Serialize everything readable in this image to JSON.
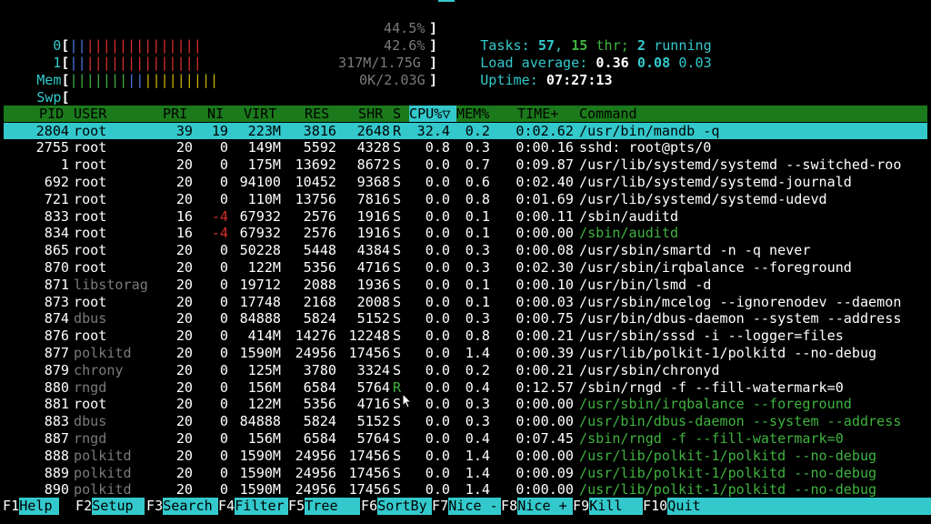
{
  "meters": {
    "cpu0": {
      "label": "0",
      "percent": "44.5%",
      "bars_blue": "||",
      "bars_red": "||||||||||||||"
    },
    "cpu1": {
      "label": "1",
      "percent": "42.6%",
      "bars_blue": "||",
      "bars_red": "||||||||||||||"
    },
    "mem": {
      "label": "Mem",
      "value": "317M/1.75G",
      "bars_green": "|||||||",
      "bars_blue": "||",
      "bars_yellow": "|||||||||"
    },
    "swp": {
      "label": "Swp",
      "value": "0K/2.03G"
    }
  },
  "summary": {
    "tasks_label": "Tasks:",
    "tasks": "57",
    "thr": "15",
    "thr_label": "thr;",
    "running": "2",
    "running_label": "running",
    "load_label": "Load average:",
    "load1": "0.36",
    "load5": "0.08",
    "load15": "0.03",
    "uptime_label": "Uptime:",
    "uptime": "07:27:13"
  },
  "columns": {
    "pid": "PID",
    "user": "USER",
    "pri": "PRI",
    "ni": "NI",
    "virt": "VIRT",
    "res": "RES",
    "shr": "SHR",
    "s": "S",
    "cpu": "CPU%▽",
    "mem": "MEM%",
    "time": "TIME+",
    "command": "Command"
  },
  "processes": [
    {
      "pid": "2804",
      "user": "root",
      "pri": "39",
      "ni": "19",
      "virt": "223M",
      "res": "3816",
      "shr": "2648",
      "s": "R",
      "cpu": "32.4",
      "mem": "0.2",
      "time": "0:02.62",
      "command": "/usr/bin/mandb -q"
    },
    {
      "pid": "2755",
      "user": "root",
      "pri": "20",
      "ni": "0",
      "virt": "149M",
      "res": "5592",
      "shr": "4328",
      "s": "S",
      "cpu": "0.8",
      "mem": "0.3",
      "time": "0:00.16",
      "command": "sshd: root@pts/0"
    },
    {
      "pid": "1",
      "user": "root",
      "pri": "20",
      "ni": "0",
      "virt": "175M",
      "res": "13692",
      "shr": "8672",
      "s": "S",
      "cpu": "0.0",
      "mem": "0.7",
      "time": "0:09.87",
      "command": "/usr/lib/systemd/systemd --switched-roo"
    },
    {
      "pid": "692",
      "user": "root",
      "pri": "20",
      "ni": "0",
      "virt": "94100",
      "res": "10452",
      "shr": "9368",
      "s": "S",
      "cpu": "0.0",
      "mem": "0.6",
      "time": "0:02.40",
      "command": "/usr/lib/systemd/systemd-journald"
    },
    {
      "pid": "721",
      "user": "root",
      "pri": "20",
      "ni": "0",
      "virt": "110M",
      "res": "13756",
      "shr": "7816",
      "s": "S",
      "cpu": "0.0",
      "mem": "0.8",
      "time": "0:01.69",
      "command": "/usr/lib/systemd/systemd-udevd"
    },
    {
      "pid": "833",
      "user": "root",
      "pri": "16",
      "ni": "-4",
      "virt": "67932",
      "res": "2576",
      "shr": "1916",
      "s": "S",
      "cpu": "0.0",
      "mem": "0.1",
      "time": "0:00.11",
      "command": "/sbin/auditd"
    },
    {
      "pid": "834",
      "user": "root",
      "pri": "16",
      "ni": "-4",
      "virt": "67932",
      "res": "2576",
      "shr": "1916",
      "s": "S",
      "cpu": "0.0",
      "mem": "0.1",
      "time": "0:00.00",
      "command": "/sbin/auditd",
      "thread": true
    },
    {
      "pid": "865",
      "user": "root",
      "pri": "20",
      "ni": "0",
      "virt": "50228",
      "res": "5448",
      "shr": "4384",
      "s": "S",
      "cpu": "0.0",
      "mem": "0.3",
      "time": "0:00.08",
      "command": "/usr/sbin/smartd -n -q never"
    },
    {
      "pid": "870",
      "user": "root",
      "pri": "20",
      "ni": "0",
      "virt": "122M",
      "res": "5356",
      "shr": "4716",
      "s": "S",
      "cpu": "0.0",
      "mem": "0.3",
      "time": "0:02.30",
      "command": "/usr/sbin/irqbalance --foreground"
    },
    {
      "pid": "871",
      "user": "libstorag",
      "pri": "20",
      "ni": "0",
      "virt": "19712",
      "res": "2088",
      "shr": "1936",
      "s": "S",
      "cpu": "0.0",
      "mem": "0.1",
      "time": "0:00.10",
      "command": "/usr/bin/lsmd -d",
      "dimuser": true
    },
    {
      "pid": "873",
      "user": "root",
      "pri": "20",
      "ni": "0",
      "virt": "17748",
      "res": "2168",
      "shr": "2008",
      "s": "S",
      "cpu": "0.0",
      "mem": "0.1",
      "time": "0:00.03",
      "command": "/usr/sbin/mcelog --ignorenodev --daemon"
    },
    {
      "pid": "874",
      "user": "dbus",
      "pri": "20",
      "ni": "0",
      "virt": "84888",
      "res": "5824",
      "shr": "5152",
      "s": "S",
      "cpu": "0.0",
      "mem": "0.3",
      "time": "0:00.75",
      "command": "/usr/bin/dbus-daemon --system --address",
      "dimuser": true
    },
    {
      "pid": "876",
      "user": "root",
      "pri": "20",
      "ni": "0",
      "virt": "414M",
      "res": "14276",
      "shr": "12248",
      "s": "S",
      "cpu": "0.0",
      "mem": "0.8",
      "time": "0:00.21",
      "command": "/usr/sbin/sssd -i --logger=files"
    },
    {
      "pid": "877",
      "user": "polkitd",
      "pri": "20",
      "ni": "0",
      "virt": "1590M",
      "res": "24956",
      "shr": "17456",
      "s": "S",
      "cpu": "0.0",
      "mem": "1.4",
      "time": "0:00.39",
      "command": "/usr/lib/polkit-1/polkitd --no-debug",
      "dimuser": true
    },
    {
      "pid": "879",
      "user": "chrony",
      "pri": "20",
      "ni": "0",
      "virt": "125M",
      "res": "3780",
      "shr": "3324",
      "s": "S",
      "cpu": "0.0",
      "mem": "0.2",
      "time": "0:00.21",
      "command": "/usr/sbin/chronyd",
      "dimuser": true
    },
    {
      "pid": "880",
      "user": "rngd",
      "pri": "20",
      "ni": "0",
      "virt": "156M",
      "res": "6584",
      "shr": "5764",
      "s": "R",
      "cpu": "0.0",
      "mem": "0.4",
      "time": "0:12.57",
      "command": "/sbin/rngd -f --fill-watermark=0",
      "dimuser": true,
      "greenstate": true
    },
    {
      "pid": "881",
      "user": "root",
      "pri": "20",
      "ni": "0",
      "virt": "122M",
      "res": "5356",
      "shr": "4716",
      "s": "S",
      "cpu": "0.0",
      "mem": "0.3",
      "time": "0:00.00",
      "command": "/usr/sbin/irqbalance --foreground",
      "thread": true
    },
    {
      "pid": "883",
      "user": "dbus",
      "pri": "20",
      "ni": "0",
      "virt": "84888",
      "res": "5824",
      "shr": "5152",
      "s": "S",
      "cpu": "0.0",
      "mem": "0.3",
      "time": "0:00.00",
      "command": "/usr/bin/dbus-daemon --system --address",
      "thread": true,
      "dimuser": true
    },
    {
      "pid": "887",
      "user": "rngd",
      "pri": "20",
      "ni": "0",
      "virt": "156M",
      "res": "6584",
      "shr": "5764",
      "s": "S",
      "cpu": "0.0",
      "mem": "0.4",
      "time": "0:07.45",
      "command": "/sbin/rngd -f --fill-watermark=0",
      "thread": true,
      "dimuser": true
    },
    {
      "pid": "888",
      "user": "polkitd",
      "pri": "20",
      "ni": "0",
      "virt": "1590M",
      "res": "24956",
      "shr": "17456",
      "s": "S",
      "cpu": "0.0",
      "mem": "1.4",
      "time": "0:00.00",
      "command": "/usr/lib/polkit-1/polkitd --no-debug",
      "thread": true,
      "dimuser": true
    },
    {
      "pid": "889",
      "user": "polkitd",
      "pri": "20",
      "ni": "0",
      "virt": "1590M",
      "res": "24956",
      "shr": "17456",
      "s": "S",
      "cpu": "0.0",
      "mem": "1.4",
      "time": "0:00.09",
      "command": "/usr/lib/polkit-1/polkitd --no-debug",
      "thread": true,
      "dimuser": true
    },
    {
      "pid": "890",
      "user": "polkitd",
      "pri": "20",
      "ni": "0",
      "virt": "1590M",
      "res": "24956",
      "shr": "17456",
      "s": "S",
      "cpu": "0.0",
      "mem": "1.4",
      "time": "0:00.00",
      "command": "/usr/lib/polkit-1/polkitd --no-debug",
      "thread": true,
      "dimuser": true
    }
  ],
  "footer": [
    {
      "key": "F1",
      "label": "Help"
    },
    {
      "key": "F2",
      "label": "Setup"
    },
    {
      "key": "F3",
      "label": "Search"
    },
    {
      "key": "F4",
      "label": "Filter"
    },
    {
      "key": "F5",
      "label": "Tree"
    },
    {
      "key": "F6",
      "label": "SortBy"
    },
    {
      "key": "F7",
      "label": "Nice -"
    },
    {
      "key": "F8",
      "label": "Nice +"
    },
    {
      "key": "F9",
      "label": "Kill"
    },
    {
      "key": "F10",
      "label": "Quit"
    }
  ],
  "colors": {
    "cyan": "#33c9cc",
    "green": "#1b7a1b",
    "red": "#d9302b",
    "yellow": "#c9b300",
    "blue": "#4a78e0"
  },
  "icons": {
    "mouse": "mouse-pointer-icon"
  }
}
